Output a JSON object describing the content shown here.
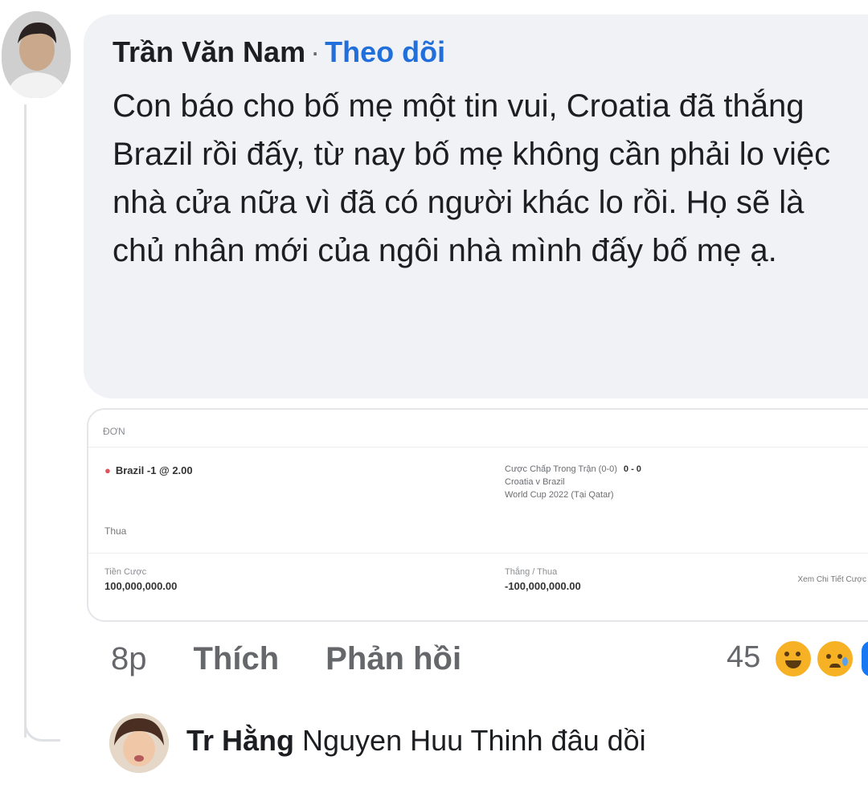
{
  "comment": {
    "author": "Trần Văn Nam",
    "separator": "·",
    "follow_label": "Theo dõi",
    "text": "Con báo cho bố mẹ một tin vui, Croatia đã thắng Brazil rồi đấy, từ nay bố mẹ không cần phải lo việc nhà cửa nữa vì đã có người khác lo rồi. Họ sẽ là chủ nhân mới của ngôi nhà mình đấy bố mẹ ạ.",
    "time": "8p",
    "like_label": "Thích",
    "reply_label": "Phản hồi",
    "reaction_count": "45",
    "reactions": [
      "haha-icon",
      "sad-icon",
      "like-icon"
    ]
  },
  "bet_slip": {
    "header": "ĐƠN",
    "pick": "Brazil -1 @ 2.00",
    "market": "Cược Chấp Trong Trận (0-0)",
    "score": "0 - 0",
    "match": "Croatia v Brazil",
    "competition": "World Cup 2022 (Tại Qatar)",
    "status": "Thua",
    "stake_label": "Tiền Cược",
    "stake_value": "100,000,000.00",
    "winloss_label": "Thắng / Thua",
    "winloss_value": "-100,000,000.00",
    "detail_link": "Xem Chi Tiết Cược"
  },
  "reply": {
    "author": "Tr Hằng",
    "text": "Nguyen Huu Thinh đâu dồi"
  },
  "colors": {
    "bubble_bg": "#f0f2f5",
    "follow": "#216fdb",
    "meta_text": "#65676b",
    "haha": "#f7b125",
    "like": "#1877f2"
  }
}
